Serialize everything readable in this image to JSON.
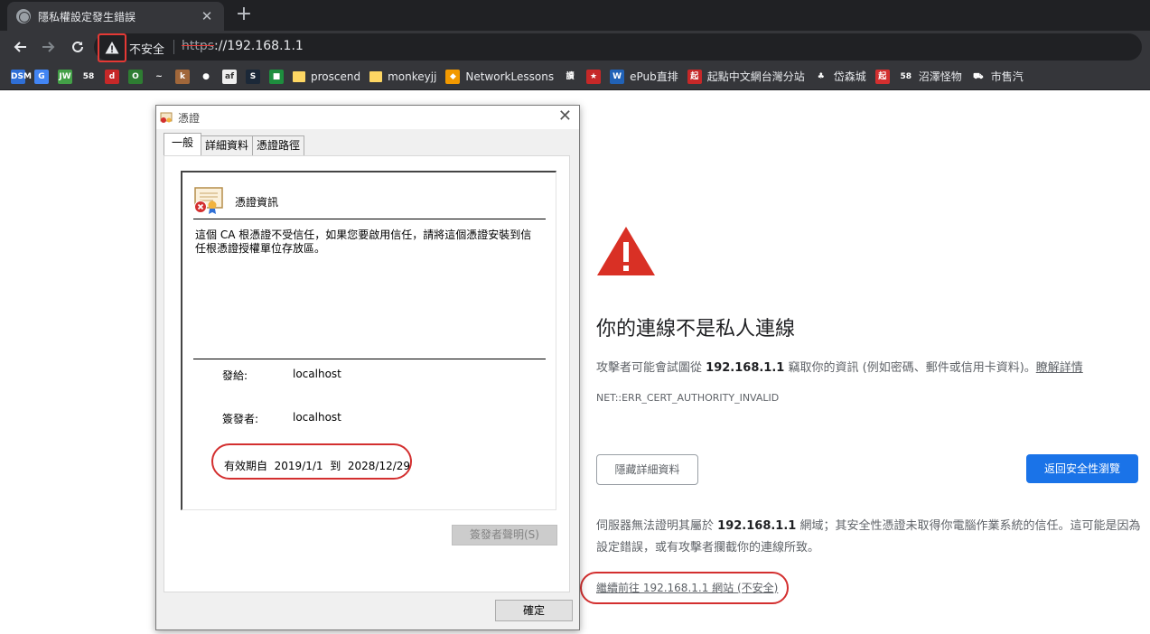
{
  "browser": {
    "tab_title": "隱私權設定發生錯誤",
    "tab_close": "✕",
    "new_tab": "+",
    "not_secure": "不安全",
    "url_scheme": "https",
    "url_rest": "://192.168.1.1"
  },
  "bookmarks": [
    {
      "icon": "DSM",
      "color": "#2f6fd6",
      "label": ""
    },
    {
      "icon": "G",
      "color": "#4285f4",
      "label": ""
    },
    {
      "icon": "JW",
      "color": "#43a047",
      "label": ""
    },
    {
      "icon": "58",
      "color": "#35363a",
      "label": ""
    },
    {
      "icon": "d",
      "color": "#c62828",
      "label": ""
    },
    {
      "icon": "O",
      "color": "#2e7d32",
      "label": ""
    },
    {
      "icon": "~",
      "color": "#35363a",
      "label": ""
    },
    {
      "icon": "k",
      "color": "#a1673a",
      "label": ""
    },
    {
      "icon": "●",
      "color": "#35363a",
      "label": ""
    },
    {
      "icon": "af",
      "color": "#eeeeee",
      "label": ""
    },
    {
      "icon": "S",
      "color": "#1b2838",
      "label": ""
    },
    {
      "icon": "■",
      "color": "#1e8e3e",
      "label": ""
    },
    {
      "icon": "",
      "color": "folder",
      "label": "proscend"
    },
    {
      "icon": "",
      "color": "folder",
      "label": "monkeyjj"
    },
    {
      "icon": "◆",
      "color": "#f29900",
      "label": "NetworkLessons"
    },
    {
      "icon": "讀",
      "color": "#35363a",
      "label": ""
    },
    {
      "icon": "★",
      "color": "#c62828",
      "label": ""
    },
    {
      "icon": "W",
      "color": "#2162b7",
      "label": "ePub直排"
    },
    {
      "icon": "起",
      "color": "#c62828",
      "label": "起點中文網台灣分站"
    },
    {
      "icon": "♣",
      "color": "#35363a",
      "label": "岱森城"
    },
    {
      "icon": "起",
      "color": "#d32f2f",
      "label": ""
    },
    {
      "icon": "58",
      "color": "#35363a",
      "label": "沼澤怪物"
    },
    {
      "icon": "⛟",
      "color": "#35363a",
      "label": "市售汽"
    }
  ],
  "error_page": {
    "heading": "你的連線不是私人連線",
    "desc_pre": "攻擊者可能會試圖從",
    "desc_host": "192.168.1.1",
    "desc_post": "竊取你的資訊 (例如密碼、郵件或信用卡資料)。",
    "learn_more": "瞭解詳情",
    "error_code": "NET::ERR_CERT_AUTHORITY_INVALID",
    "hide_details": "隱藏詳細資料",
    "back_to_safety": "返回安全性瀏覽",
    "explain_pre": "伺服器無法證明其屬於",
    "explain_host": "192.168.1.1",
    "explain_post": "網域；其安全性憑證未取得你電腦作業系統的信任。這可能是因為設定錯誤，或有攻擊者攔截你的連線所致。",
    "proceed_link": "繼續前往 192.168.1.1 網站 (不安全)"
  },
  "cert_dialog": {
    "title": "憑證",
    "close": "✕",
    "tabs": [
      "一般",
      "詳細資料",
      "憑證路徑"
    ],
    "info_title": "憑證資訊",
    "warning": "這個 CA 根憑證不受信任，如果您要啟用信任，請將這個憑證安裝到信任根憑證授權單位存放區。",
    "issued_to_label": "發給:",
    "issued_to": "localhost",
    "issued_by_label": "簽發者:",
    "issued_by": "localhost",
    "valid_from_label": "有效期自",
    "valid_from": "2019/1/1",
    "valid_to_label": "到",
    "valid_to": "2028/12/29",
    "issuer_statement": "簽發者聲明(S)",
    "ok": "確定"
  }
}
